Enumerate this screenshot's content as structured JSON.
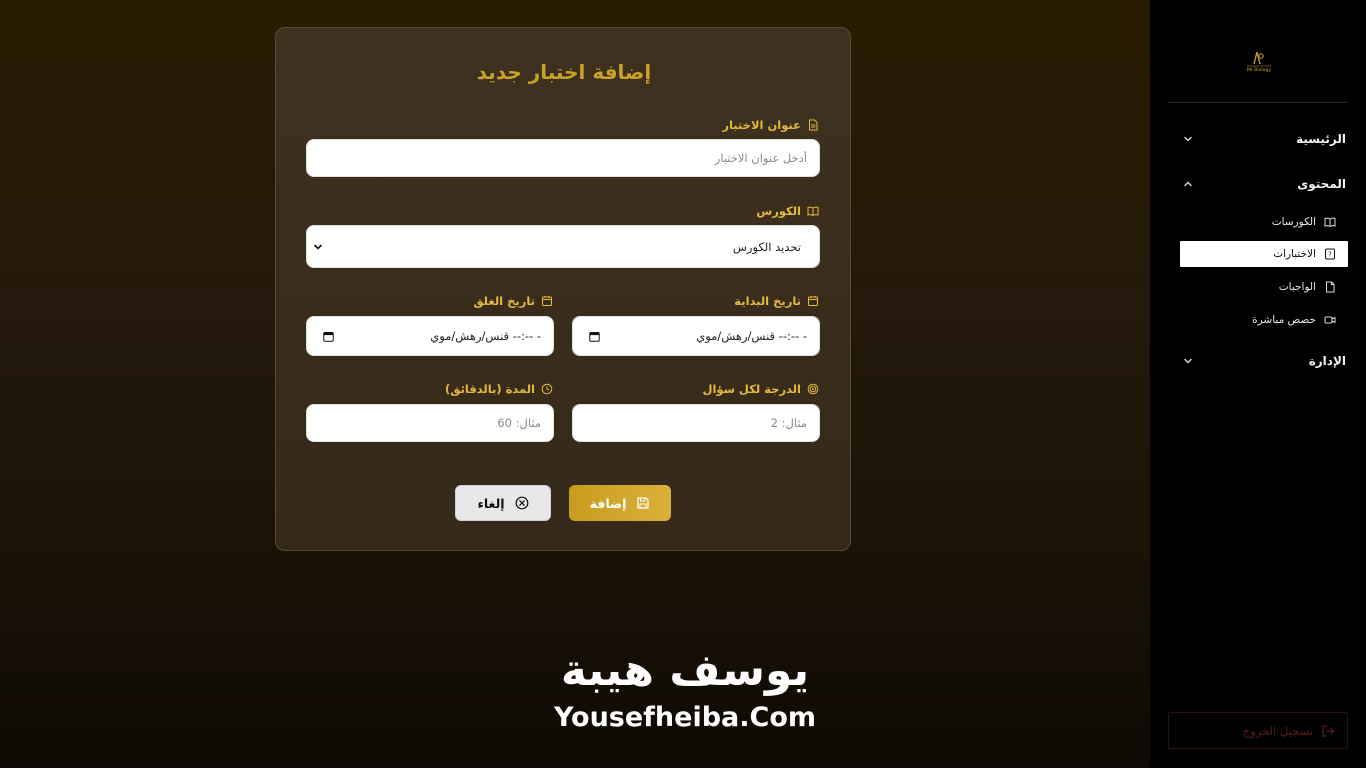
{
  "sidebar": {
    "logo_text": "Mr Biology",
    "sections": [
      {
        "label": "الرئيسية",
        "expanded": false
      },
      {
        "label": "المحتوى",
        "expanded": true
      },
      {
        "label": "الإدارة",
        "expanded": false
      }
    ],
    "content_items": [
      {
        "label": "الكورسات",
        "icon": "book-open-icon"
      },
      {
        "label": "الاختبارات",
        "icon": "quiz-icon",
        "active": true
      },
      {
        "label": "الواجبات",
        "icon": "file-icon"
      },
      {
        "label": "حصص مباشرة",
        "icon": "video-icon"
      }
    ],
    "logout_label": "تسجيل الخروج"
  },
  "form": {
    "title": "إضافة اختبار جديد",
    "exam_title": {
      "label": "عنوان الاختبار",
      "placeholder": "أدخل عنوان الاختبار",
      "value": ""
    },
    "course": {
      "label": "الكورس",
      "selected": "تحديد الكورس"
    },
    "start_date": {
      "label": "تاريخ البداية",
      "value": "قنس/رهش/موي --:-- -"
    },
    "end_date": {
      "label": "تاريخ الغلق",
      "value": "قنس/رهش/موي --:-- -"
    },
    "grade_per_question": {
      "label": "الدرجة لكل سؤال",
      "placeholder": "مثال: 2"
    },
    "duration": {
      "label": "المدة (بالدقائق)",
      "placeholder": "مثال: 60"
    },
    "submit_label": "إضافة",
    "cancel_label": "إلغاء"
  },
  "watermark": {
    "arabic": "يوسف هيبة",
    "english": "Yousefheiba.Com"
  },
  "colors": {
    "accent": "#c9a227",
    "label": "#e3b93f",
    "logout": "#5a1d1d"
  }
}
